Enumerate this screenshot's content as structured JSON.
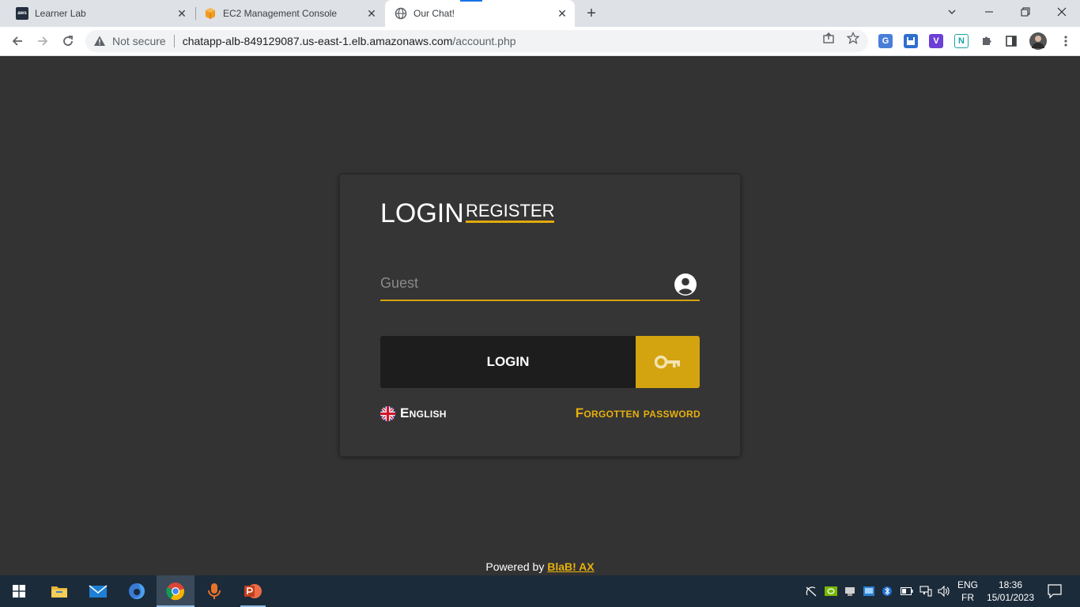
{
  "browser": {
    "tabs": [
      {
        "title": "Learner Lab",
        "favicon": "aws-icon",
        "active": false
      },
      {
        "title": "EC2 Management Console",
        "favicon": "aws-cube-icon",
        "active": false
      },
      {
        "title": "Our Chat!",
        "favicon": "globe-icon",
        "active": true
      }
    ],
    "security_label": "Not secure",
    "url_host": "chatapp-alb-849129087.us-east-1.elb.amazonaws.com",
    "url_path": "/account.php",
    "aws_favicon_text": "aws"
  },
  "page": {
    "login_heading": "LOGIN",
    "register_link": "REGISTER",
    "username_placeholder": "Guest",
    "username_value": "",
    "login_button": "LOGIN",
    "language": "English",
    "forgot_password": "Forgotten password",
    "powered_by_prefix": "Powered by",
    "powered_by_brand": "BlaB! AX",
    "colors": {
      "background": "#333333",
      "card": "#353535",
      "accent": "#d4a310",
      "button_dark": "#1d1d1d"
    }
  },
  "taskbar": {
    "pinned": [
      "windows-start",
      "file-explorer",
      "mail",
      "firefox",
      "chrome",
      "voice-recorder",
      "powerpoint"
    ],
    "lang_line1": "ENG",
    "lang_line2": "FR",
    "time": "18:36",
    "date": "15/01/2023"
  }
}
